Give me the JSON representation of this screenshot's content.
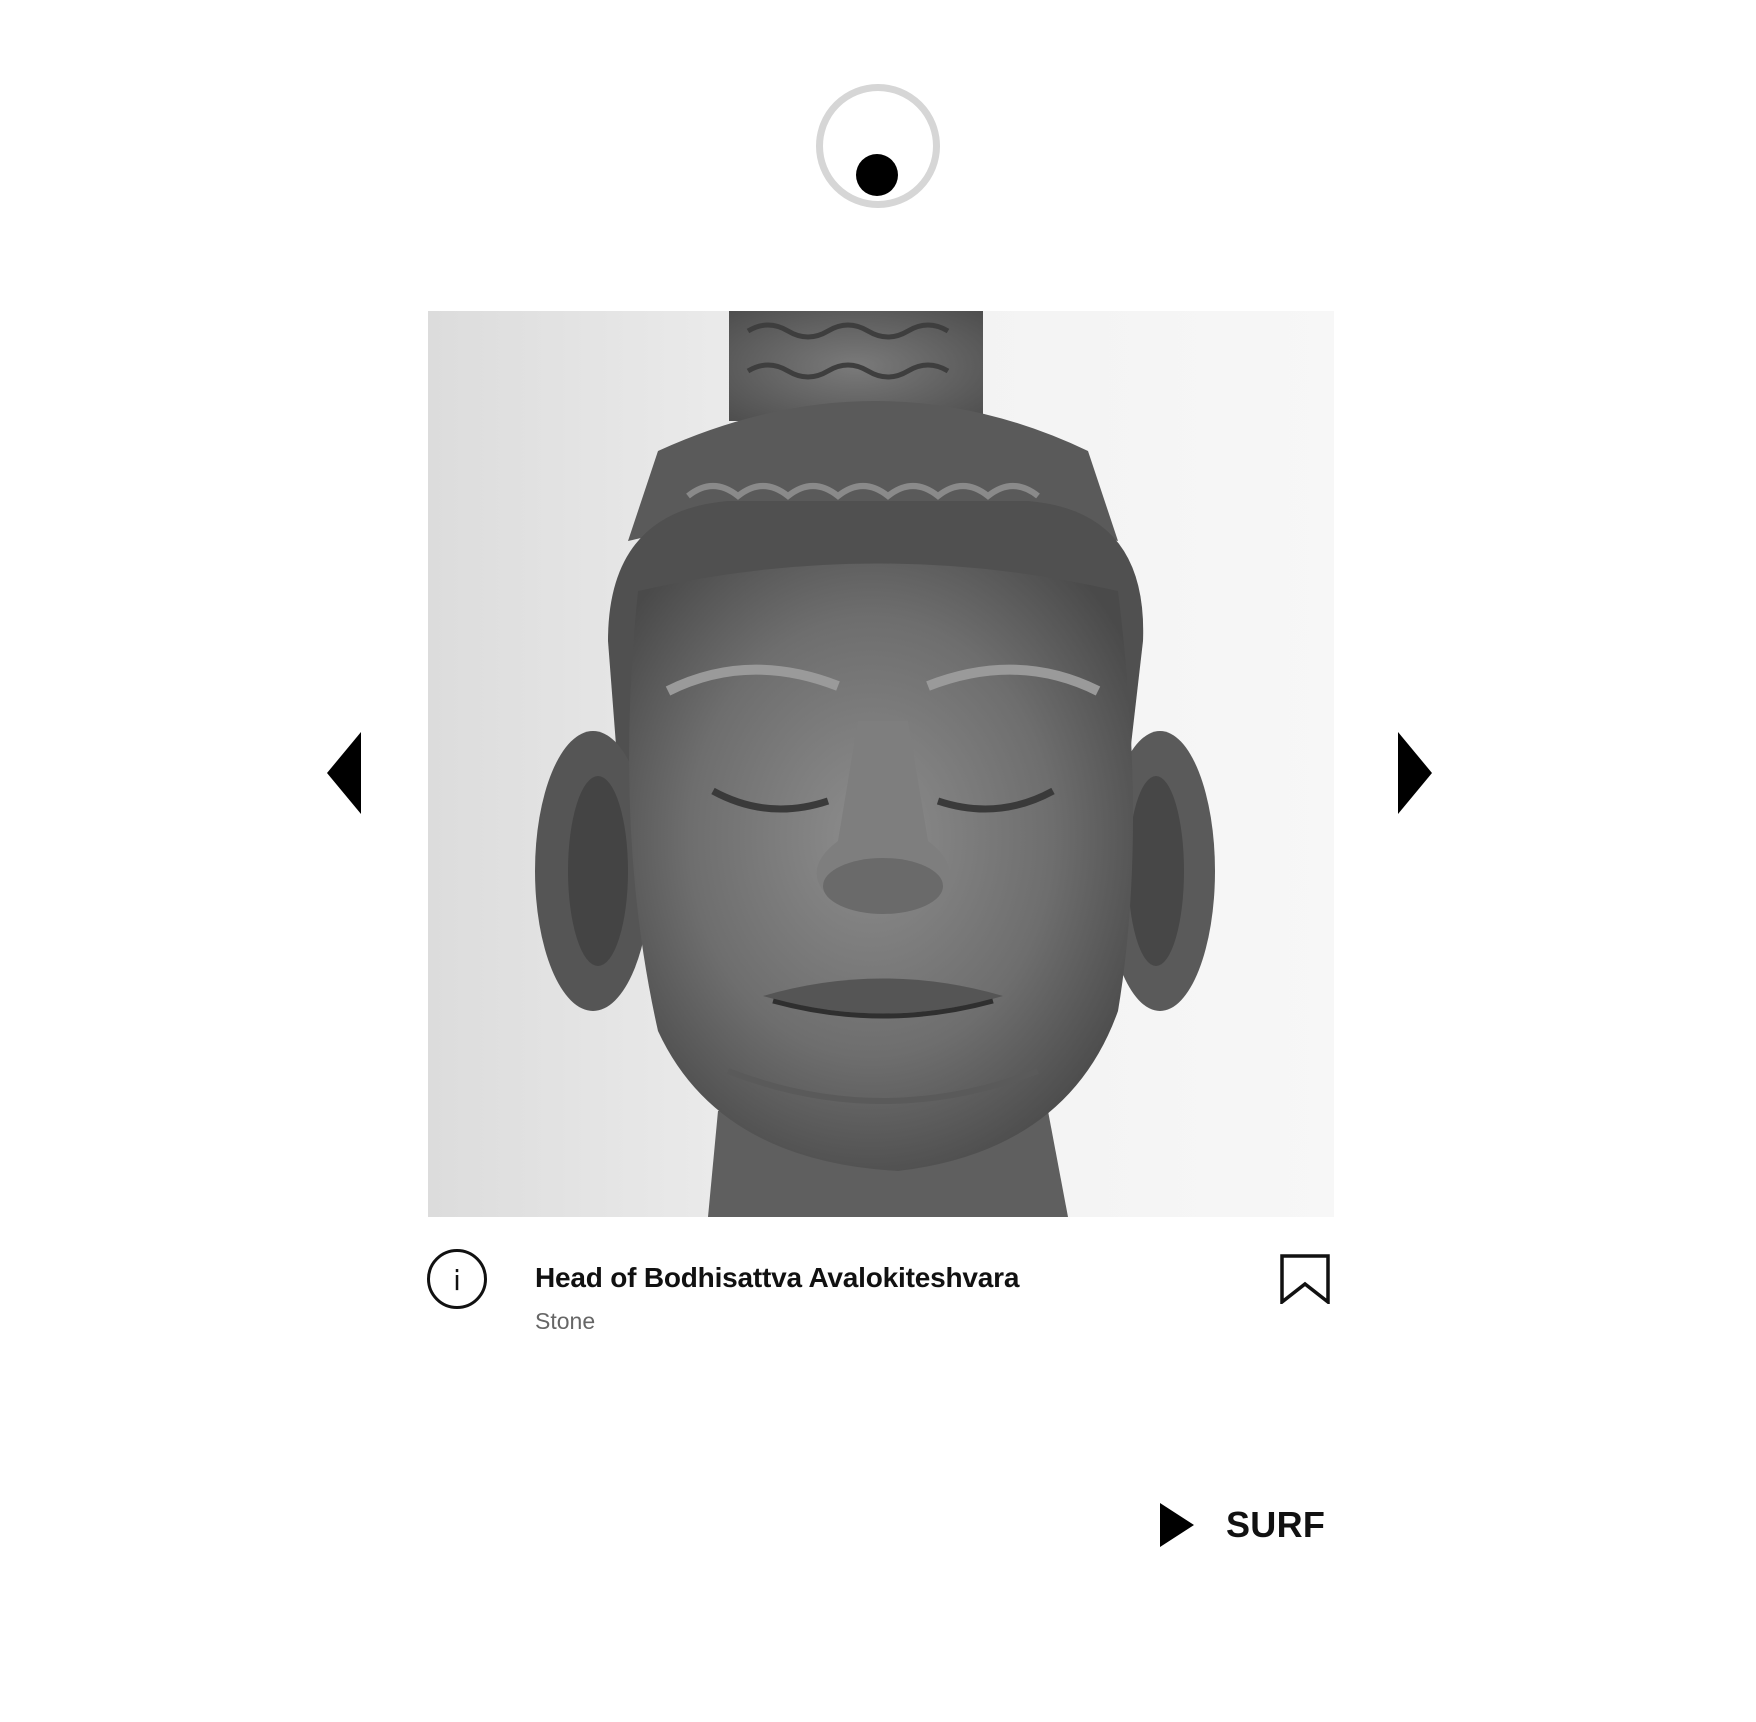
{
  "header": {
    "logo_icon": "eye-icon"
  },
  "artwork": {
    "title": "Head of Bodhisattva Avalokiteshvara",
    "medium": "Stone",
    "image_icon": "sculpture-head-image"
  },
  "navigation": {
    "prev_icon": "chevron-left-icon",
    "next_icon": "chevron-right-icon"
  },
  "caption": {
    "info_glyph": "i",
    "info_icon": "info-icon",
    "bookmark_icon": "bookmark-icon"
  },
  "surf": {
    "label": "SURF",
    "icon": "play-icon"
  },
  "colors": {
    "background": "#ffffff",
    "text": "#111111",
    "subtext": "#666666",
    "logo_ring": "#d6d6d6"
  }
}
